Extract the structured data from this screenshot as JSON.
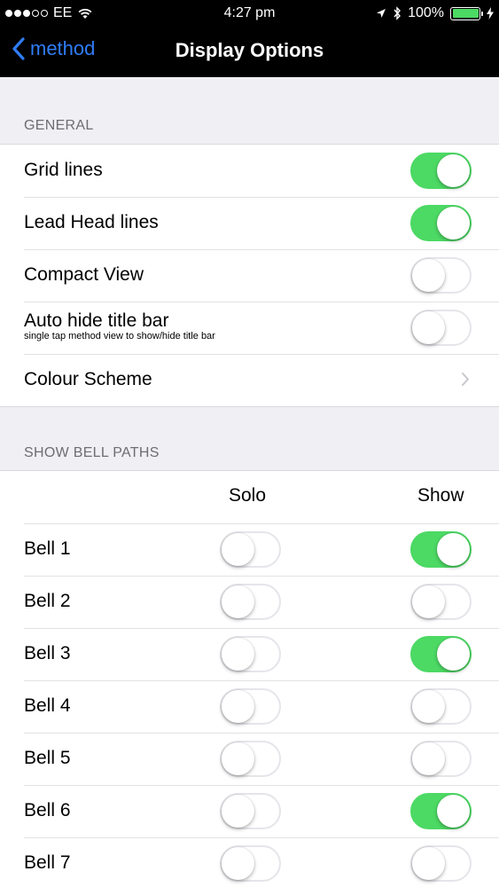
{
  "status_bar": {
    "carrier": "EE",
    "time": "4:27 pm",
    "battery_percent": "100%",
    "signal_bars_filled": 3,
    "signal_bars_total": 5
  },
  "nav": {
    "back_label": "method",
    "title": "Display Options"
  },
  "general": {
    "header": "GENERAL",
    "rows": [
      {
        "label": "Grid lines",
        "on": true
      },
      {
        "label": "Lead Head lines",
        "on": true
      },
      {
        "label": "Compact View",
        "on": false
      },
      {
        "label": "Auto hide title bar",
        "sublabel": "single tap method view to show/hide title bar",
        "on": false
      }
    ],
    "colour_scheme_label": "Colour Scheme"
  },
  "bell_paths": {
    "header": "SHOW BELL PATHS",
    "solo_label": "Solo",
    "show_label": "Show",
    "bells": [
      {
        "label": "Bell 1",
        "solo": false,
        "show": true
      },
      {
        "label": "Bell 2",
        "solo": false,
        "show": false
      },
      {
        "label": "Bell 3",
        "solo": false,
        "show": true
      },
      {
        "label": "Bell 4",
        "solo": false,
        "show": false
      },
      {
        "label": "Bell 5",
        "solo": false,
        "show": false
      },
      {
        "label": "Bell 6",
        "solo": false,
        "show": true
      },
      {
        "label": "Bell 7",
        "solo": false,
        "show": false
      }
    ]
  },
  "colors": {
    "accent": "#2f7cf6",
    "switch_on": "#4cd964",
    "background": "#efeff4"
  }
}
